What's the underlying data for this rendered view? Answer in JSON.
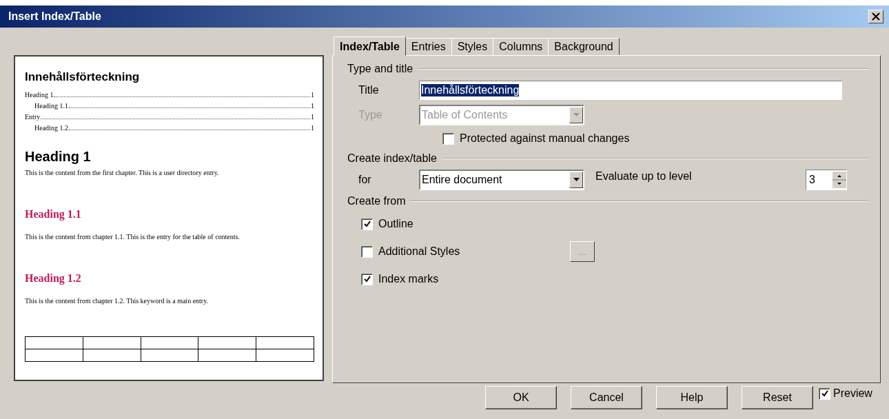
{
  "window": {
    "title": "Insert Index/Table"
  },
  "preview": {
    "blocks": [
      {
        "kind": "title",
        "text": "Innehållsförteckning"
      },
      {
        "kind": "toc",
        "entries": [
          {
            "text": "Heading 1",
            "page": "1",
            "children": [
              {
                "text": "Heading 1.1",
                "page": "1"
              }
            ]
          },
          {
            "text": "Entry",
            "page": "1",
            "children": [
              {
                "text": "Heading 1.2",
                "page": "1"
              }
            ]
          }
        ]
      },
      {
        "kind": "heading1",
        "text": "Heading 1"
      },
      {
        "kind": "paragraph",
        "text": "This is the content from the first chapter. This is a user directory entry."
      },
      {
        "kind": "heading2",
        "text": "Heading 1.1"
      },
      {
        "kind": "paragraph",
        "text": "This is the content from chapter 1.1. This is the entry for the table of contents."
      },
      {
        "kind": "heading2",
        "text": "Heading 1.2"
      },
      {
        "kind": "paragraph",
        "text": "This is the content from chapter 1.2. This keyword is a main entry."
      },
      {
        "kind": "table"
      }
    ]
  },
  "tabs": [
    {
      "label": "Index/Table",
      "selected": true
    },
    {
      "label": "Entries",
      "selected": false
    },
    {
      "label": "Styles",
      "selected": false
    },
    {
      "label": "Columns",
      "selected": false
    },
    {
      "label": "Background",
      "selected": false
    }
  ],
  "type_and_title": {
    "heading": "Type and title",
    "title_field": {
      "label": "Title",
      "value": "Innehållsförteckning",
      "selected": true
    },
    "type_field": {
      "label": "Type",
      "value": "Table of Contents",
      "disabled": true
    },
    "protected": {
      "label": "Protected against manual changes",
      "checked": false
    }
  },
  "create_index": {
    "heading": "Create index/table",
    "for_field": {
      "label": "for",
      "value": "Entire document"
    },
    "level": {
      "label": "Evaluate up to level",
      "value": "3"
    }
  },
  "create_from": {
    "heading": "Create from",
    "options": [
      {
        "label": "Outline",
        "checked": true
      },
      {
        "label": "Additional Styles",
        "checked": false,
        "button": {
          "label": "...",
          "disabled": true
        }
      },
      {
        "label": "Index marks",
        "checked": true
      }
    ]
  },
  "buttons": [
    {
      "label": "OK"
    },
    {
      "label": "Cancel"
    },
    {
      "label": "Help"
    },
    {
      "label": "Reset"
    }
  ],
  "preview_toggle": {
    "label": "Preview",
    "checked": true
  }
}
